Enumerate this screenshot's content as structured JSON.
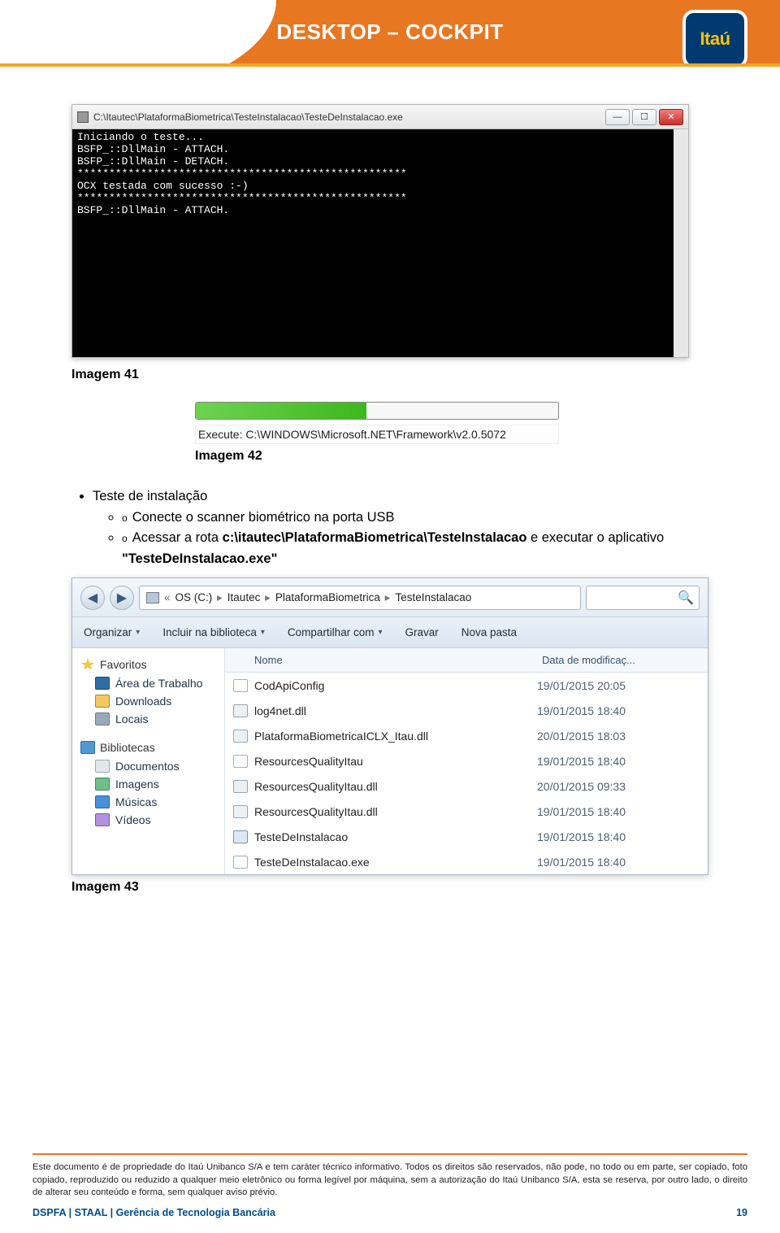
{
  "header": {
    "title": "DESKTOP – COCKPIT",
    "logo_text": "Itaú"
  },
  "console": {
    "title": "C:\\Itautec\\PlataformaBiometrica\\TesteInstalacao\\TesteDeInstalacao.exe",
    "lines": "Iniciando o teste...\nBSFP_::DllMain - ATTACH.\nBSFP_::DllMain - DETACH.\n****************************************************\nOCX testada com sucesso :-)\n****************************************************\nBSFP_::DllMain - ATTACH.",
    "btn_min": "—",
    "btn_max": "☐",
    "btn_close": "✕"
  },
  "captions": {
    "img41": "Imagem 41",
    "img42": "Imagem 42",
    "img43": "Imagem 43"
  },
  "progress": {
    "text": "Execute: C:\\WINDOWS\\Microsoft.NET\\Framework\\v2.0.5072"
  },
  "instructions": {
    "bullet": "Teste de instalação",
    "sub1": "Conecte o scanner biométrico na porta USB",
    "sub2_a": "Acessar a rota ",
    "sub2_b": "c:\\itautec\\PlataformaBiometrica\\TesteInstalacao",
    "sub2_c": " e executar o aplicativo ",
    "sub2_d": "\"TesteDeInstalacao.exe\""
  },
  "explorer": {
    "crumbs": [
      "OS (C:)",
      "Itautec",
      "PlataformaBiometrica",
      "TesteInstalacao"
    ],
    "toolbar": {
      "organize": "Organizar",
      "include": "Incluir na biblioteca",
      "share": "Compartilhar com",
      "burn": "Gravar",
      "newfolder": "Nova pasta"
    },
    "nav": {
      "favorites": "Favoritos",
      "desk": "Área de Trabalho",
      "downloads": "Downloads",
      "places": "Locais",
      "libraries": "Bibliotecas",
      "docs": "Documentos",
      "images": "Imagens",
      "music": "Músicas",
      "videos": "Vídeos"
    },
    "columns": {
      "name": "Nome",
      "date": "Data de modificaç..."
    },
    "files": [
      {
        "icon": "ic-file",
        "name": "CodApiConfig",
        "date": "19/01/2015 20:05"
      },
      {
        "icon": "ic-dll",
        "name": "log4net.dll",
        "date": "19/01/2015 18:40"
      },
      {
        "icon": "ic-dll",
        "name": "PlataformaBiometricaICLX_Itau.dll",
        "date": "20/01/2015 18:03"
      },
      {
        "icon": "ic-file",
        "name": "ResourcesQualityItau",
        "date": "19/01/2015 18:40"
      },
      {
        "icon": "ic-dll",
        "name": "ResourcesQualityItau.dll",
        "date": "20/01/2015 09:33"
      },
      {
        "icon": "ic-dll",
        "name": "ResourcesQualityItau.dll",
        "date": "19/01/2015 18:40"
      },
      {
        "icon": "ic-app",
        "name": "TesteDeInstalacao",
        "date": "19/01/2015 18:40"
      },
      {
        "icon": "ic-file",
        "name": "TesteDeInstalacao.exe",
        "date": "19/01/2015 18:40"
      }
    ]
  },
  "footer": {
    "legal": "Este documento é de propriedade do Itaú Unibanco S/A e tem caráter técnico informativo. Todos os direitos são reservados, não pode, no todo ou em parte, ser copiado, foto copiado, reproduzido ou reduzido a qualquer meio eletrônico ou forma legível por máquina, sem a autorização do Itaú Unibanco S/A, esta se reserva, por outro lado, o direito de alterar seu conteúdo e forma, sem qualquer aviso prévio.",
    "line_left": "DSPFA | STAAL | Gerência de Tecnologia Bancária",
    "page": "19"
  }
}
